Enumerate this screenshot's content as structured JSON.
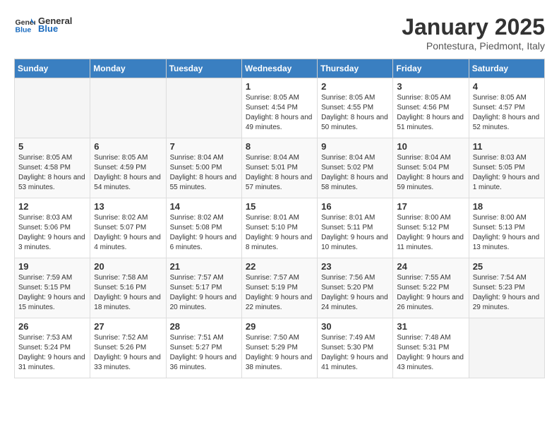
{
  "header": {
    "logo_general": "General",
    "logo_blue": "Blue",
    "month_title": "January 2025",
    "location": "Pontestura, Piedmont, Italy"
  },
  "days_of_week": [
    "Sunday",
    "Monday",
    "Tuesday",
    "Wednesday",
    "Thursday",
    "Friday",
    "Saturday"
  ],
  "weeks": [
    [
      {
        "day": "",
        "info": ""
      },
      {
        "day": "",
        "info": ""
      },
      {
        "day": "",
        "info": ""
      },
      {
        "day": "1",
        "info": "Sunrise: 8:05 AM\nSunset: 4:54 PM\nDaylight: 8 hours and 49 minutes."
      },
      {
        "day": "2",
        "info": "Sunrise: 8:05 AM\nSunset: 4:55 PM\nDaylight: 8 hours and 50 minutes."
      },
      {
        "day": "3",
        "info": "Sunrise: 8:05 AM\nSunset: 4:56 PM\nDaylight: 8 hours and 51 minutes."
      },
      {
        "day": "4",
        "info": "Sunrise: 8:05 AM\nSunset: 4:57 PM\nDaylight: 8 hours and 52 minutes."
      }
    ],
    [
      {
        "day": "5",
        "info": "Sunrise: 8:05 AM\nSunset: 4:58 PM\nDaylight: 8 hours and 53 minutes."
      },
      {
        "day": "6",
        "info": "Sunrise: 8:05 AM\nSunset: 4:59 PM\nDaylight: 8 hours and 54 minutes."
      },
      {
        "day": "7",
        "info": "Sunrise: 8:04 AM\nSunset: 5:00 PM\nDaylight: 8 hours and 55 minutes."
      },
      {
        "day": "8",
        "info": "Sunrise: 8:04 AM\nSunset: 5:01 PM\nDaylight: 8 hours and 57 minutes."
      },
      {
        "day": "9",
        "info": "Sunrise: 8:04 AM\nSunset: 5:02 PM\nDaylight: 8 hours and 58 minutes."
      },
      {
        "day": "10",
        "info": "Sunrise: 8:04 AM\nSunset: 5:04 PM\nDaylight: 8 hours and 59 minutes."
      },
      {
        "day": "11",
        "info": "Sunrise: 8:03 AM\nSunset: 5:05 PM\nDaylight: 9 hours and 1 minute."
      }
    ],
    [
      {
        "day": "12",
        "info": "Sunrise: 8:03 AM\nSunset: 5:06 PM\nDaylight: 9 hours and 3 minutes."
      },
      {
        "day": "13",
        "info": "Sunrise: 8:02 AM\nSunset: 5:07 PM\nDaylight: 9 hours and 4 minutes."
      },
      {
        "day": "14",
        "info": "Sunrise: 8:02 AM\nSunset: 5:08 PM\nDaylight: 9 hours and 6 minutes."
      },
      {
        "day": "15",
        "info": "Sunrise: 8:01 AM\nSunset: 5:10 PM\nDaylight: 9 hours and 8 minutes."
      },
      {
        "day": "16",
        "info": "Sunrise: 8:01 AM\nSunset: 5:11 PM\nDaylight: 9 hours and 10 minutes."
      },
      {
        "day": "17",
        "info": "Sunrise: 8:00 AM\nSunset: 5:12 PM\nDaylight: 9 hours and 11 minutes."
      },
      {
        "day": "18",
        "info": "Sunrise: 8:00 AM\nSunset: 5:13 PM\nDaylight: 9 hours and 13 minutes."
      }
    ],
    [
      {
        "day": "19",
        "info": "Sunrise: 7:59 AM\nSunset: 5:15 PM\nDaylight: 9 hours and 15 minutes."
      },
      {
        "day": "20",
        "info": "Sunrise: 7:58 AM\nSunset: 5:16 PM\nDaylight: 9 hours and 18 minutes."
      },
      {
        "day": "21",
        "info": "Sunrise: 7:57 AM\nSunset: 5:17 PM\nDaylight: 9 hours and 20 minutes."
      },
      {
        "day": "22",
        "info": "Sunrise: 7:57 AM\nSunset: 5:19 PM\nDaylight: 9 hours and 22 minutes."
      },
      {
        "day": "23",
        "info": "Sunrise: 7:56 AM\nSunset: 5:20 PM\nDaylight: 9 hours and 24 minutes."
      },
      {
        "day": "24",
        "info": "Sunrise: 7:55 AM\nSunset: 5:22 PM\nDaylight: 9 hours and 26 minutes."
      },
      {
        "day": "25",
        "info": "Sunrise: 7:54 AM\nSunset: 5:23 PM\nDaylight: 9 hours and 29 minutes."
      }
    ],
    [
      {
        "day": "26",
        "info": "Sunrise: 7:53 AM\nSunset: 5:24 PM\nDaylight: 9 hours and 31 minutes."
      },
      {
        "day": "27",
        "info": "Sunrise: 7:52 AM\nSunset: 5:26 PM\nDaylight: 9 hours and 33 minutes."
      },
      {
        "day": "28",
        "info": "Sunrise: 7:51 AM\nSunset: 5:27 PM\nDaylight: 9 hours and 36 minutes."
      },
      {
        "day": "29",
        "info": "Sunrise: 7:50 AM\nSunset: 5:29 PM\nDaylight: 9 hours and 38 minutes."
      },
      {
        "day": "30",
        "info": "Sunrise: 7:49 AM\nSunset: 5:30 PM\nDaylight: 9 hours and 41 minutes."
      },
      {
        "day": "31",
        "info": "Sunrise: 7:48 AM\nSunset: 5:31 PM\nDaylight: 9 hours and 43 minutes."
      },
      {
        "day": "",
        "info": ""
      }
    ]
  ]
}
